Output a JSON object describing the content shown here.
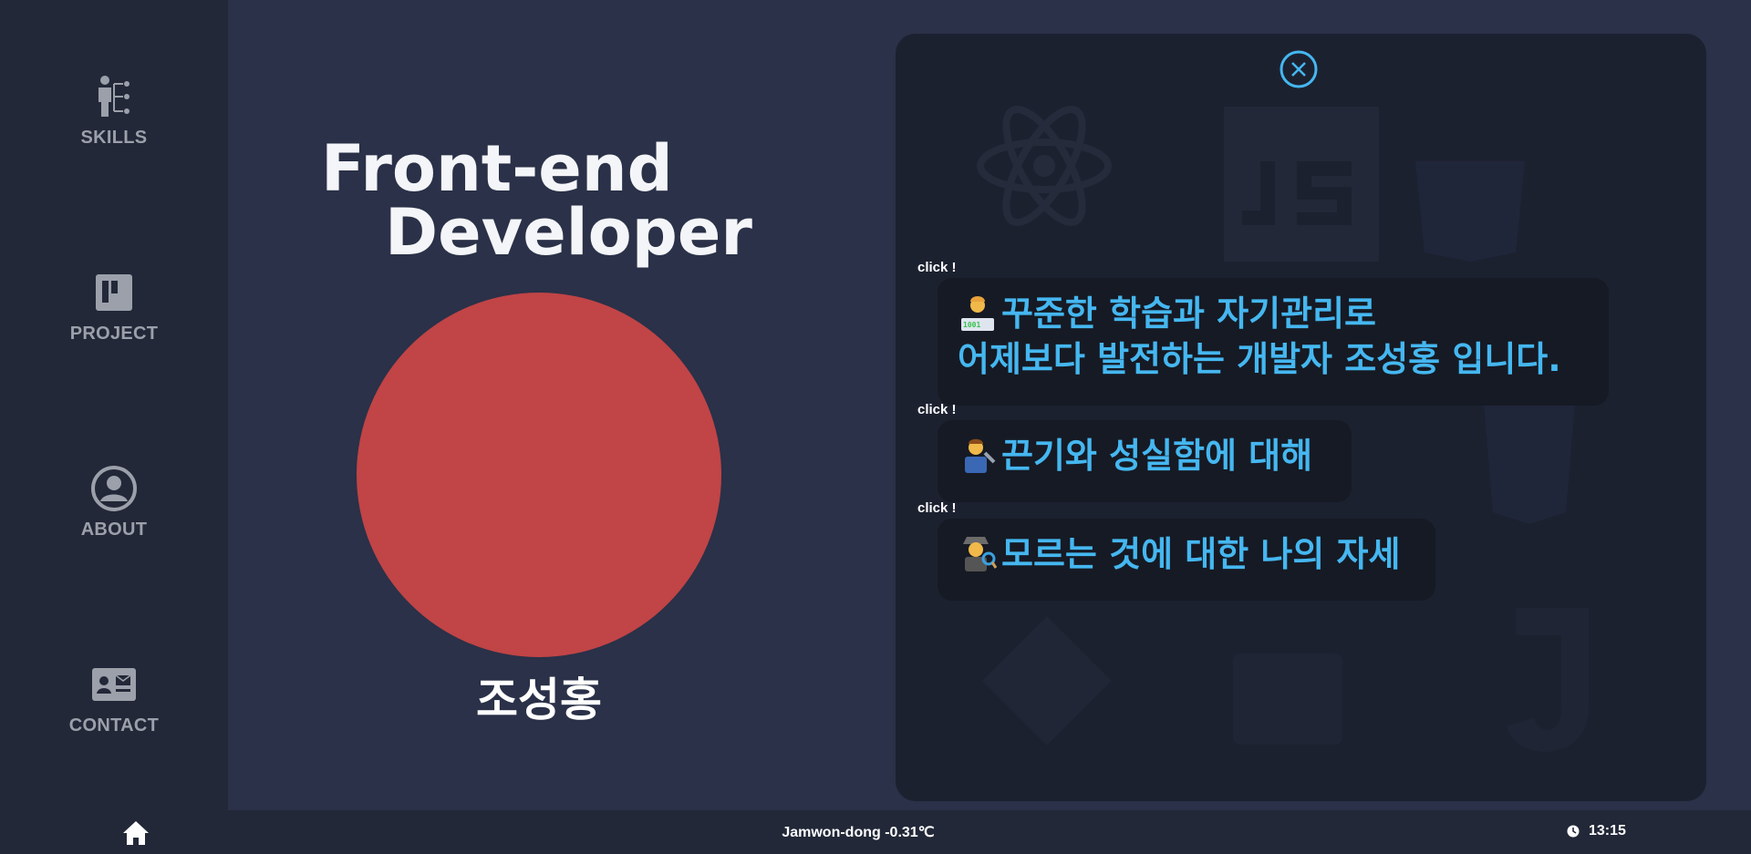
{
  "sidebar": {
    "items": [
      {
        "label": "SKILLS",
        "icon": "skills-tree-icon"
      },
      {
        "label": "PROJECT",
        "icon": "kanban-board-icon"
      },
      {
        "label": "ABOUT",
        "icon": "user-circle-icon"
      },
      {
        "label": "CONTACT",
        "icon": "contact-card-icon"
      }
    ]
  },
  "hero": {
    "title_line1": "Front-end",
    "title_line2": "Developer",
    "name": "조성홍",
    "avatar_color": "#c14446"
  },
  "panel": {
    "close_icon": "close-icon",
    "accent_color": "#45b7f0",
    "cards": [
      {
        "tag": "click !",
        "emoji": "technologist-emoji",
        "line1": "꾸준한 학습과 자기관리로",
        "line2": "어제보다 발전하는 개발자 조성홍 입니다."
      },
      {
        "tag": "click !",
        "emoji": "mechanic-emoji",
        "line1": "끈기와 성실함에 대해"
      },
      {
        "tag": "click !",
        "emoji": "detective-emoji",
        "line1": "모르는 것에 대한 나의 자세"
      }
    ]
  },
  "footer": {
    "weather": "Jamwon-dong -0.31℃",
    "time": "13:15"
  }
}
